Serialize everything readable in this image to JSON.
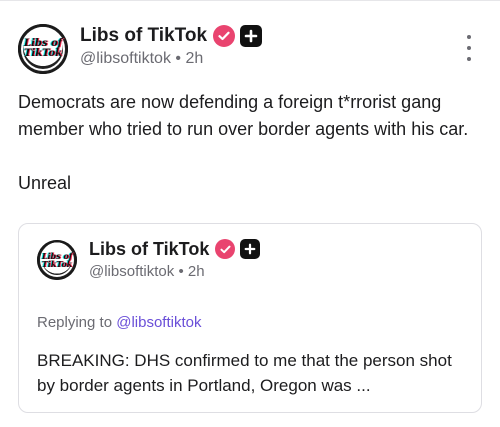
{
  "post": {
    "author": {
      "display_name": "Libs of TikTok",
      "handle": "@libsoftiktok",
      "separator": "•",
      "time": "2h",
      "avatar_text_line1": "Libs of",
      "avatar_text_line2": "TikTok"
    },
    "body": "Democrats are now defending a foreign t*rrorist gang member who tried to run over border agents with his car.\n\nUnreal",
    "more_icon": "more-vertical-icon"
  },
  "quoted_post": {
    "author": {
      "display_name": "Libs of TikTok",
      "handle": "@libsoftiktok",
      "separator": "•",
      "time": "2h",
      "avatar_text_line1": "Libs of",
      "avatar_text_line2": "TikTok"
    },
    "replying_prefix": "Replying to",
    "replying_handle": "@libsoftiktok",
    "text": "BREAKING: DHS confirmed to me that the person shot by border agents in Portland, Oregon was ..."
  },
  "colors": {
    "verified_badge": "#e9446f",
    "link": "#6a4fd8",
    "muted": "#6b6b72"
  }
}
